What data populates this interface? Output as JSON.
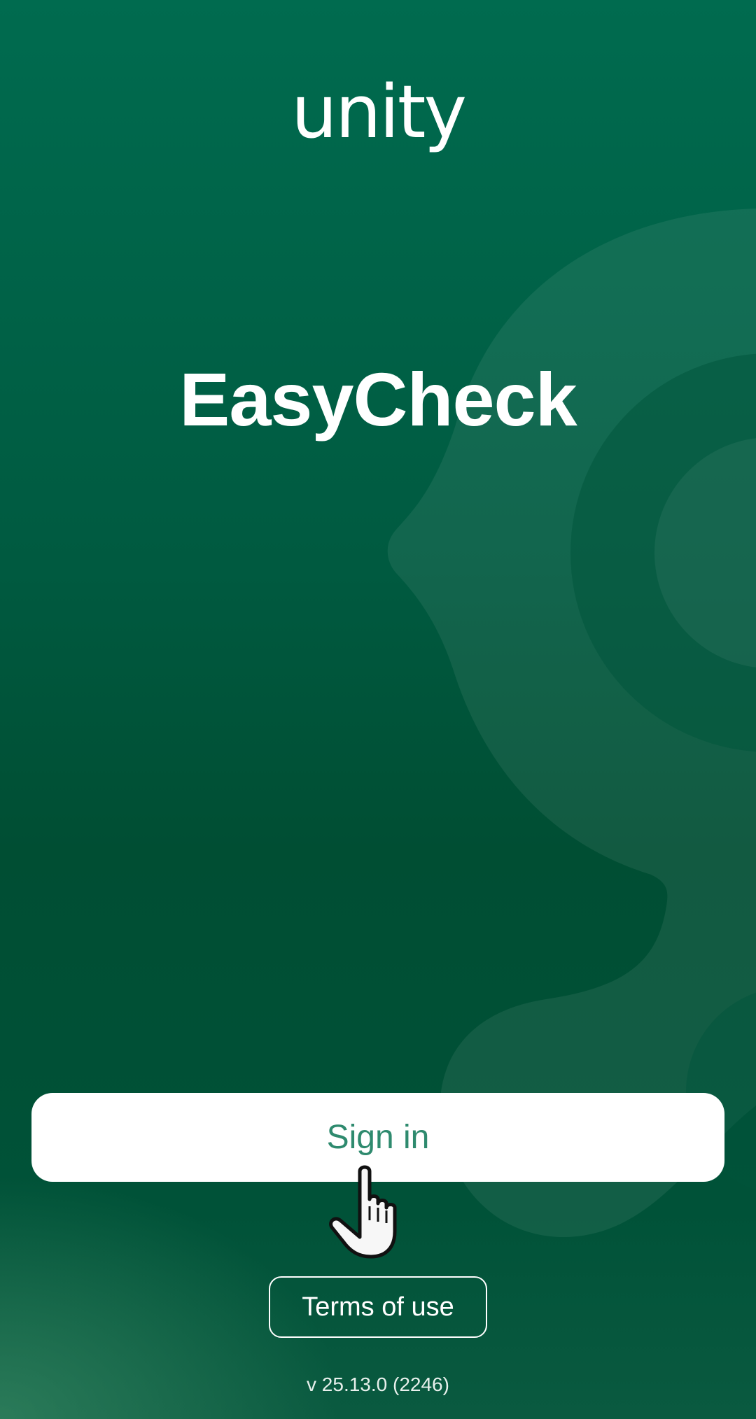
{
  "brand": {
    "logo_text": "unity",
    "app_name": "EasyCheck",
    "primary_color": "#005a40",
    "button_text_color": "#2e8a6e"
  },
  "actions": {
    "sign_in_label": "Sign in",
    "terms_label": "Terms of use"
  },
  "footer": {
    "version": "v 25.13.0 (2246)"
  },
  "icons": {
    "cursor": "hand-pointer-icon",
    "background": "decorative-ring-shape"
  }
}
